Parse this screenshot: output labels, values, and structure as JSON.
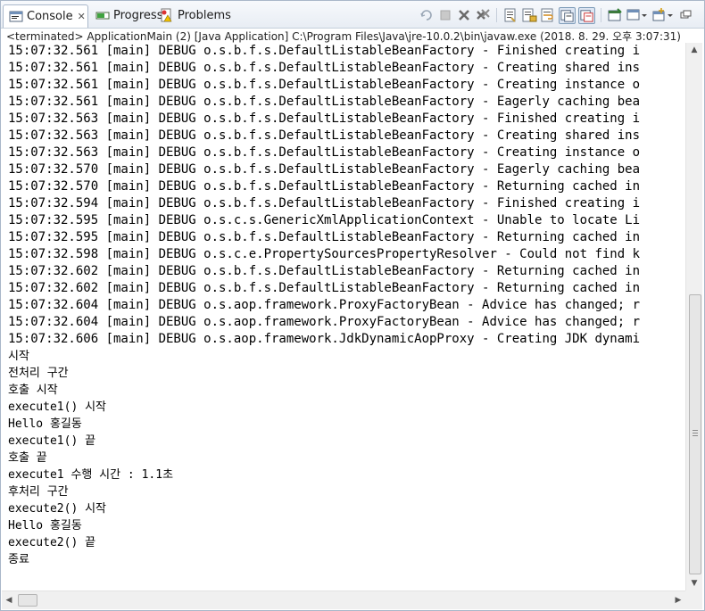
{
  "tabs": [
    {
      "label": "Console",
      "icon": "console-icon",
      "active": true
    },
    {
      "label": "Progress",
      "icon": "progress-icon",
      "active": false
    },
    {
      "label": "Problems",
      "icon": "problems-icon",
      "active": false
    }
  ],
  "toolbar_icons": [
    "remove-launch-icon",
    "terminate-icon",
    "remove-all-terminated-icon",
    "remove-all-icon",
    "clear-console-icon",
    "scroll-lock-icon",
    "word-wrap-icon",
    "show-stdout-icon",
    "show-stderr-icon",
    "pin-console-icon",
    "display-console-icon",
    "new-console-icon",
    "minimize-icon"
  ],
  "status_text": "<terminated> ApplicationMain (2) [Java Application] C:\\Program Files\\Java\\jre-10.0.2\\bin\\javaw.exe (2018. 8. 29. 오후 3:07:31)",
  "console_lines": [
    "15:07:32.561 [main] DEBUG o.s.b.f.s.DefaultListableBeanFactory - Finished creating i",
    "15:07:32.561 [main] DEBUG o.s.b.f.s.DefaultListableBeanFactory - Creating shared ins",
    "15:07:32.561 [main] DEBUG o.s.b.f.s.DefaultListableBeanFactory - Creating instance o",
    "15:07:32.561 [main] DEBUG o.s.b.f.s.DefaultListableBeanFactory - Eagerly caching bea",
    "15:07:32.563 [main] DEBUG o.s.b.f.s.DefaultListableBeanFactory - Finished creating i",
    "15:07:32.563 [main] DEBUG o.s.b.f.s.DefaultListableBeanFactory - Creating shared ins",
    "15:07:32.563 [main] DEBUG o.s.b.f.s.DefaultListableBeanFactory - Creating instance o",
    "15:07:32.570 [main] DEBUG o.s.b.f.s.DefaultListableBeanFactory - Eagerly caching bea",
    "15:07:32.570 [main] DEBUG o.s.b.f.s.DefaultListableBeanFactory - Returning cached in",
    "15:07:32.594 [main] DEBUG o.s.b.f.s.DefaultListableBeanFactory - Finished creating i",
    "15:07:32.595 [main] DEBUG o.s.c.s.GenericXmlApplicationContext - Unable to locate Li",
    "15:07:32.595 [main] DEBUG o.s.b.f.s.DefaultListableBeanFactory - Returning cached in",
    "15:07:32.598 [main] DEBUG o.s.c.e.PropertySourcesPropertyResolver - Could not find k",
    "15:07:32.602 [main] DEBUG o.s.b.f.s.DefaultListableBeanFactory - Returning cached in",
    "15:07:32.602 [main] DEBUG o.s.b.f.s.DefaultListableBeanFactory - Returning cached in",
    "15:07:32.604 [main] DEBUG o.s.aop.framework.ProxyFactoryBean - Advice has changed; r",
    "15:07:32.604 [main] DEBUG o.s.aop.framework.ProxyFactoryBean - Advice has changed; r",
    "15:07:32.606 [main] DEBUG o.s.aop.framework.JdkDynamicAopProxy - Creating JDK dynami",
    "시작",
    "전처리 구간",
    "호출 시작",
    "execute1() 시작",
    "Hello 홍길동",
    "execute1() 끝",
    "호출 끝",
    "execute1 수행 시간 : 1.1초",
    "후처리 구간",
    "execute2() 시작",
    "Hello 홍길동",
    "execute2() 끝",
    "종료"
  ]
}
